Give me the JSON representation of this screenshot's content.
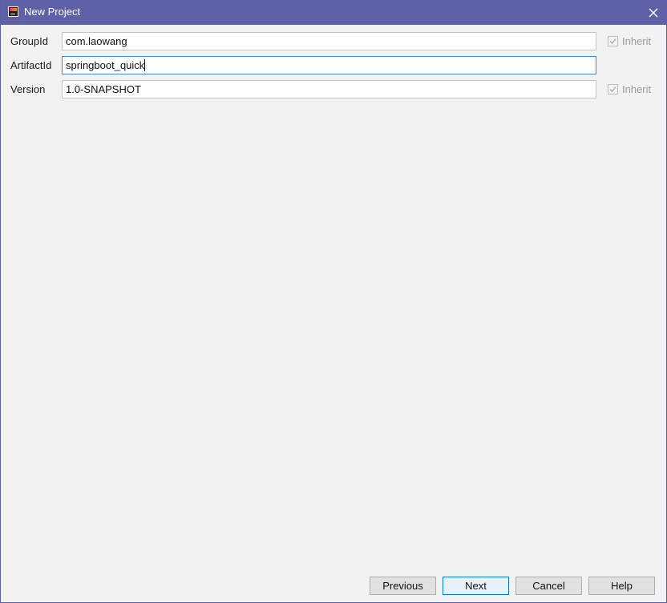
{
  "window": {
    "title": "New Project",
    "app_icon": "intellij-icon",
    "close_icon": "close-icon"
  },
  "form": {
    "rows": [
      {
        "label": "GroupId",
        "value": "com.laowang",
        "inherit_label": "Inherit",
        "inherit_checked": true
      },
      {
        "label": "ArtifactId",
        "value": "springboot_quick",
        "focused": true
      },
      {
        "label": "Version",
        "value": "1.0-SNAPSHOT",
        "inherit_label": "Inherit",
        "inherit_checked": true
      }
    ]
  },
  "buttons": {
    "previous": "Previous",
    "next": "Next",
    "cancel": "Cancel",
    "help": "Help"
  },
  "colors": {
    "titlebar": "#5f61a8",
    "background": "#f2f2f2",
    "focus_border": "#3c8cd4"
  }
}
